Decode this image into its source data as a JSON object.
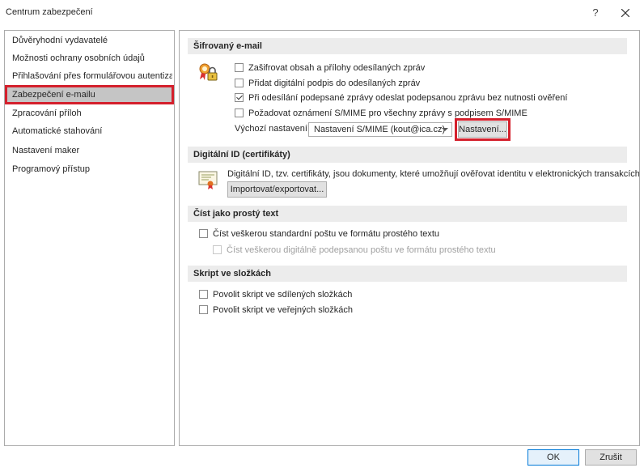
{
  "window": {
    "title": "Centrum zabezpečení",
    "help_label": "?",
    "close_label": "✕"
  },
  "sidebar": {
    "items": [
      {
        "label": "Důvěryhodní vydavatelé"
      },
      {
        "label": "Možnosti ochrany osobních údajů"
      },
      {
        "label": "Přihlašování přes formulářovou autentizaci"
      },
      {
        "label": "Zabezpečení e-mailu",
        "selected": true
      },
      {
        "label": "Zpracování příloh"
      },
      {
        "label": "Automatické stahování"
      },
      {
        "label": "Nastavení maker"
      },
      {
        "label": "Programový přístup"
      }
    ]
  },
  "encrypted": {
    "header": "Šifrovaný e-mail",
    "options": [
      {
        "label": "Zašifrovat obsah a přílohy odesílaných zpráv",
        "checked": false
      },
      {
        "label": "Přidat digitální podpis do odesílaných zpráv",
        "checked": false
      },
      {
        "label": "Při odesílání podepsané zprávy odeslat podepsanou zprávu bez nutnosti ověření",
        "checked": true
      },
      {
        "label": "Požadovat oznámení S/MIME pro všechny zprávy s podpisem S/MIME",
        "checked": false
      }
    ],
    "default_label": "Výchozí nastavení:",
    "default_value": "Nastavení S/MIME (kout@ica.cz)",
    "settings_button": "Nastavení..."
  },
  "digital_id": {
    "header": "Digitální ID (certifikáty)",
    "description": "Digitální ID, tzv. certifikáty, jsou dokumenty, které umožňují ověřovat identitu v elektronických transakcích.",
    "import_button": "Importovat/exportovat..."
  },
  "plain_text": {
    "header": "Číst jako prostý text",
    "options": [
      {
        "label": "Číst veškerou standardní poštu ve formátu prostého textu",
        "checked": false,
        "disabled": false
      },
      {
        "label": "Číst veškerou digitálně podepsanou poštu ve formátu prostého textu",
        "checked": false,
        "disabled": true
      }
    ]
  },
  "script": {
    "header": "Skript ve složkách",
    "options": [
      {
        "label": "Povolit skript ve sdílených složkách",
        "checked": false
      },
      {
        "label": "Povolit skript ve veřejných složkách",
        "checked": false
      }
    ]
  },
  "footer": {
    "ok_button": "OK",
    "cancel_button": "Zrušit"
  },
  "colors": {
    "highlight_red": "#d4202c",
    "section_bg": "#ececec",
    "selected_bg": "#c5c5c5"
  }
}
